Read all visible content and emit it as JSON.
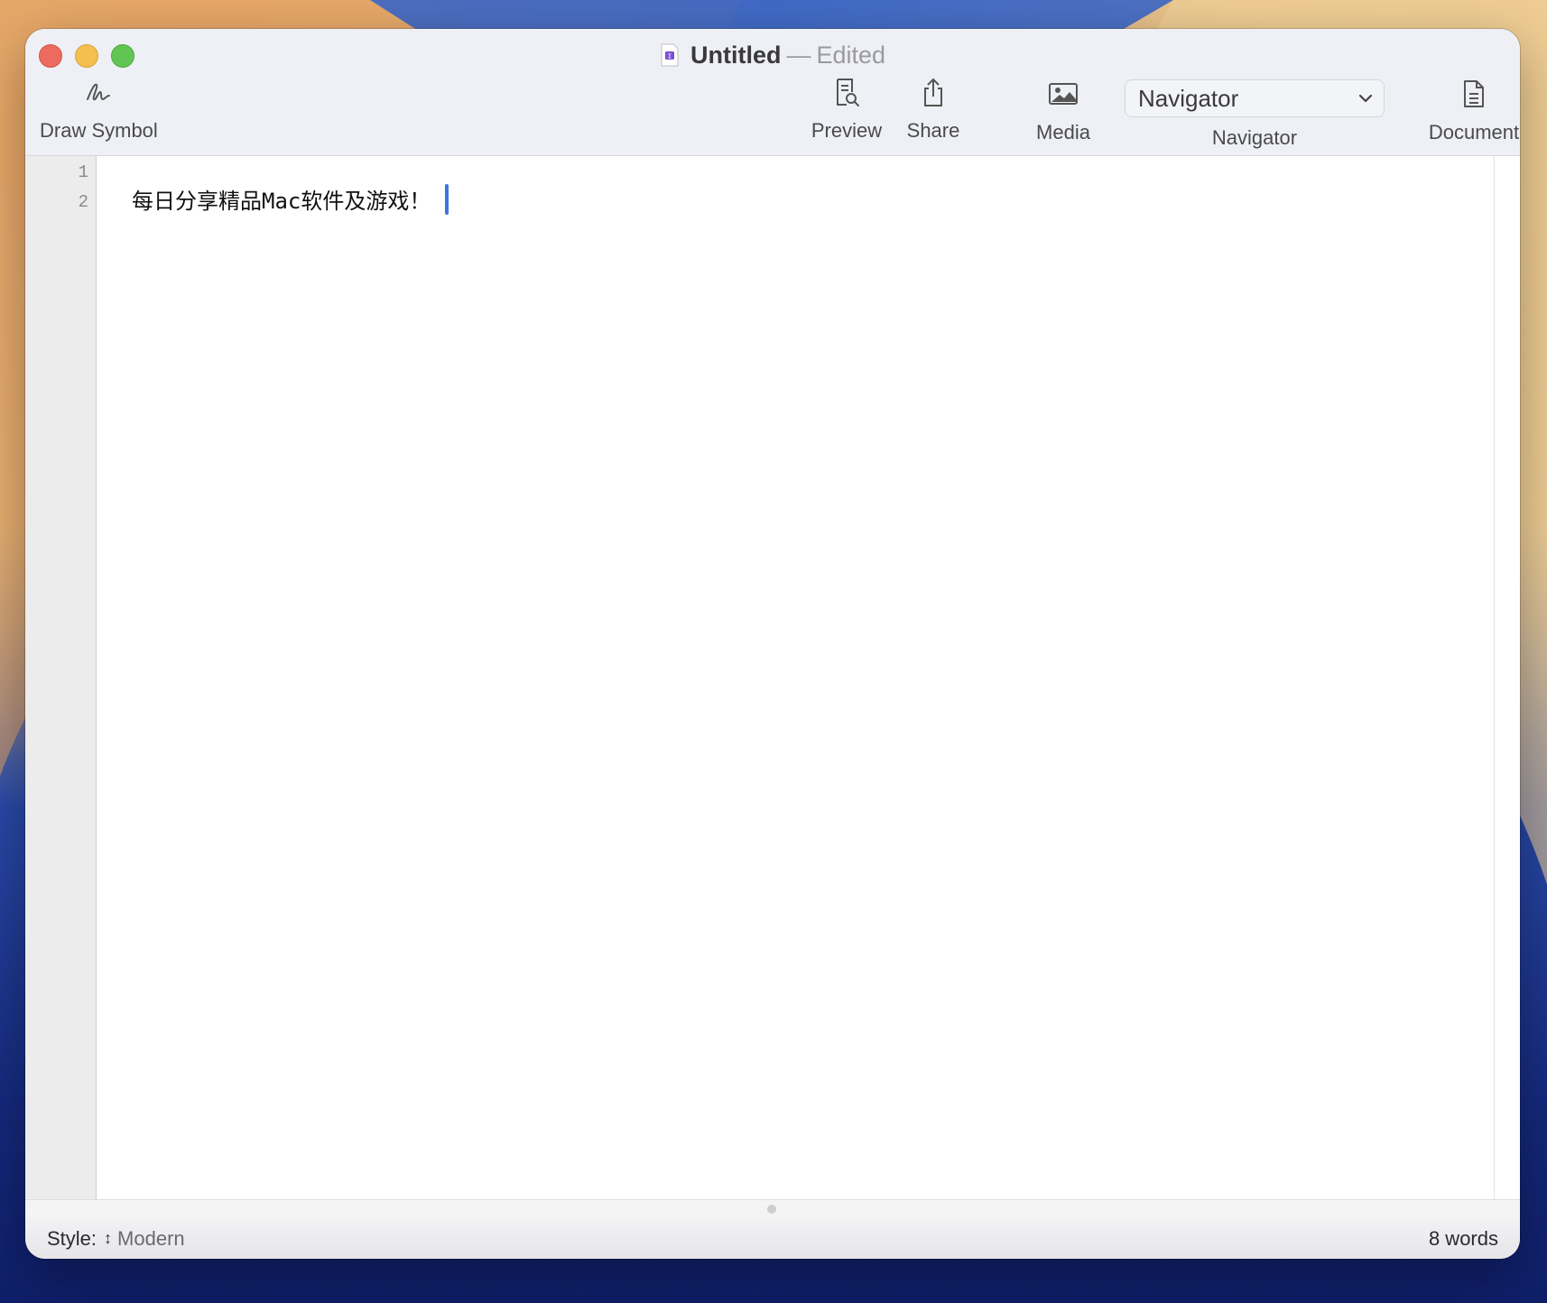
{
  "window": {
    "title": "Untitled",
    "title_separator": "—",
    "title_status": "Edited"
  },
  "toolbar": {
    "draw_symbol": {
      "label": "Draw Symbol",
      "icon": "signature-icon"
    },
    "preview": {
      "label": "Preview",
      "icon": "doc-magnifier-icon"
    },
    "share": {
      "label": "Share",
      "icon": "share-icon"
    },
    "media": {
      "label": "Media",
      "icon": "photo-icon"
    },
    "navigator": {
      "selected": "Navigator",
      "label": "Navigator",
      "icon": "chevron-down-icon"
    },
    "document": {
      "label": "Document",
      "icon": "document-icon"
    }
  },
  "editor": {
    "line_numbers": [
      "1",
      "2"
    ],
    "lines": [
      "",
      "每日分享精品Mac软件及游戏！"
    ]
  },
  "statusbar": {
    "style_label": "Style:",
    "style_value": "Modern",
    "word_count": "8 words"
  },
  "colors": {
    "caret": "#3f74e0",
    "close": "#ec6a5e",
    "minimize": "#f4bf4f",
    "maximize": "#61c554"
  }
}
